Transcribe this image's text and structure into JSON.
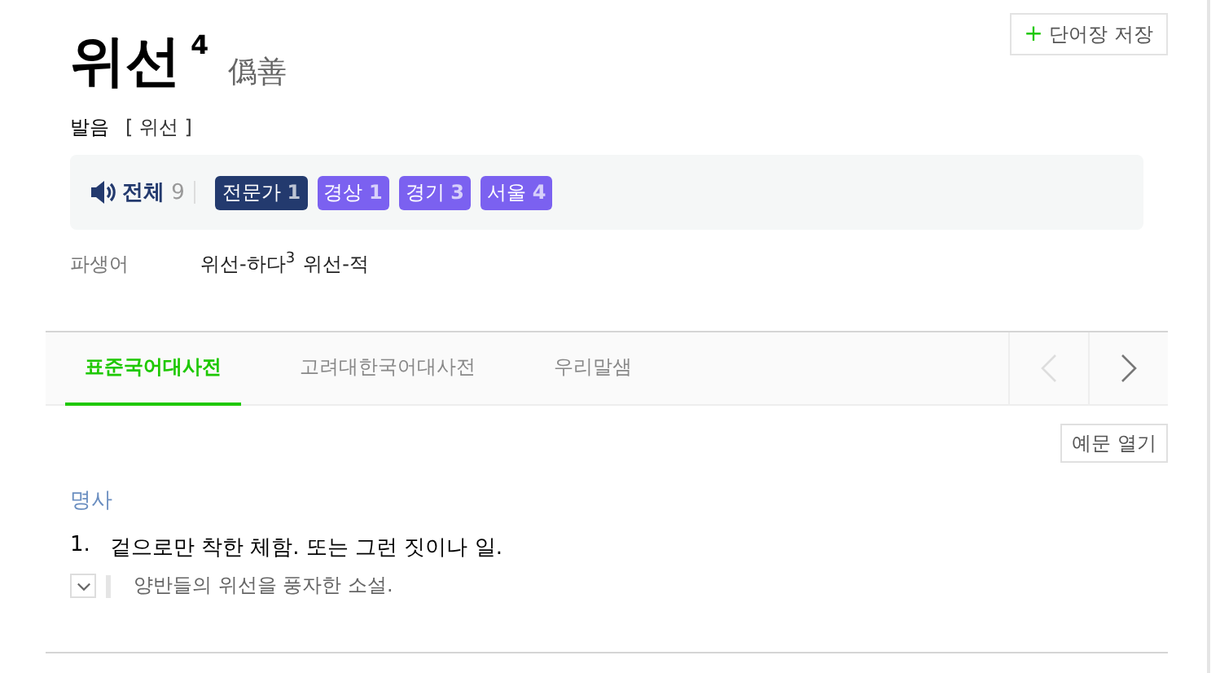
{
  "entry": {
    "word": "위선",
    "homonym": "4",
    "hanja": "僞善"
  },
  "save_button": {
    "icon": "+",
    "label": "단어장 저장"
  },
  "pronunciation": {
    "label": "발음",
    "value": "[ 위선 ]"
  },
  "audio": {
    "label": "전체",
    "count": "9",
    "badges": [
      {
        "label": "전문가",
        "count": "1",
        "color": "#233a6e"
      },
      {
        "label": "경상",
        "count": "1",
        "color": "#7b61f0"
      },
      {
        "label": "경기",
        "count": "3",
        "color": "#7b61f0"
      },
      {
        "label": "서울",
        "count": "4",
        "color": "#7b61f0"
      }
    ]
  },
  "derived": {
    "label": "파생어",
    "items": [
      {
        "text": "위선-하다",
        "sup": "3"
      },
      {
        "text": "위선-적"
      }
    ]
  },
  "tabs": [
    {
      "label": "표준국어대사전",
      "selected": true
    },
    {
      "label": "고려대한국어대사전",
      "selected": false
    },
    {
      "label": "우리말샘",
      "selected": false
    }
  ],
  "nav": {
    "prev_disabled": true,
    "next_disabled": false
  },
  "examples_button": "예문 열기",
  "pos": "명사",
  "senses": [
    {
      "number": "1.",
      "definition": "겉으로만 착한 체함. 또는 그런 짓이나 일.",
      "example": "양반들의 위선을 풍자한 소설.",
      "expanded": false
    }
  ]
}
